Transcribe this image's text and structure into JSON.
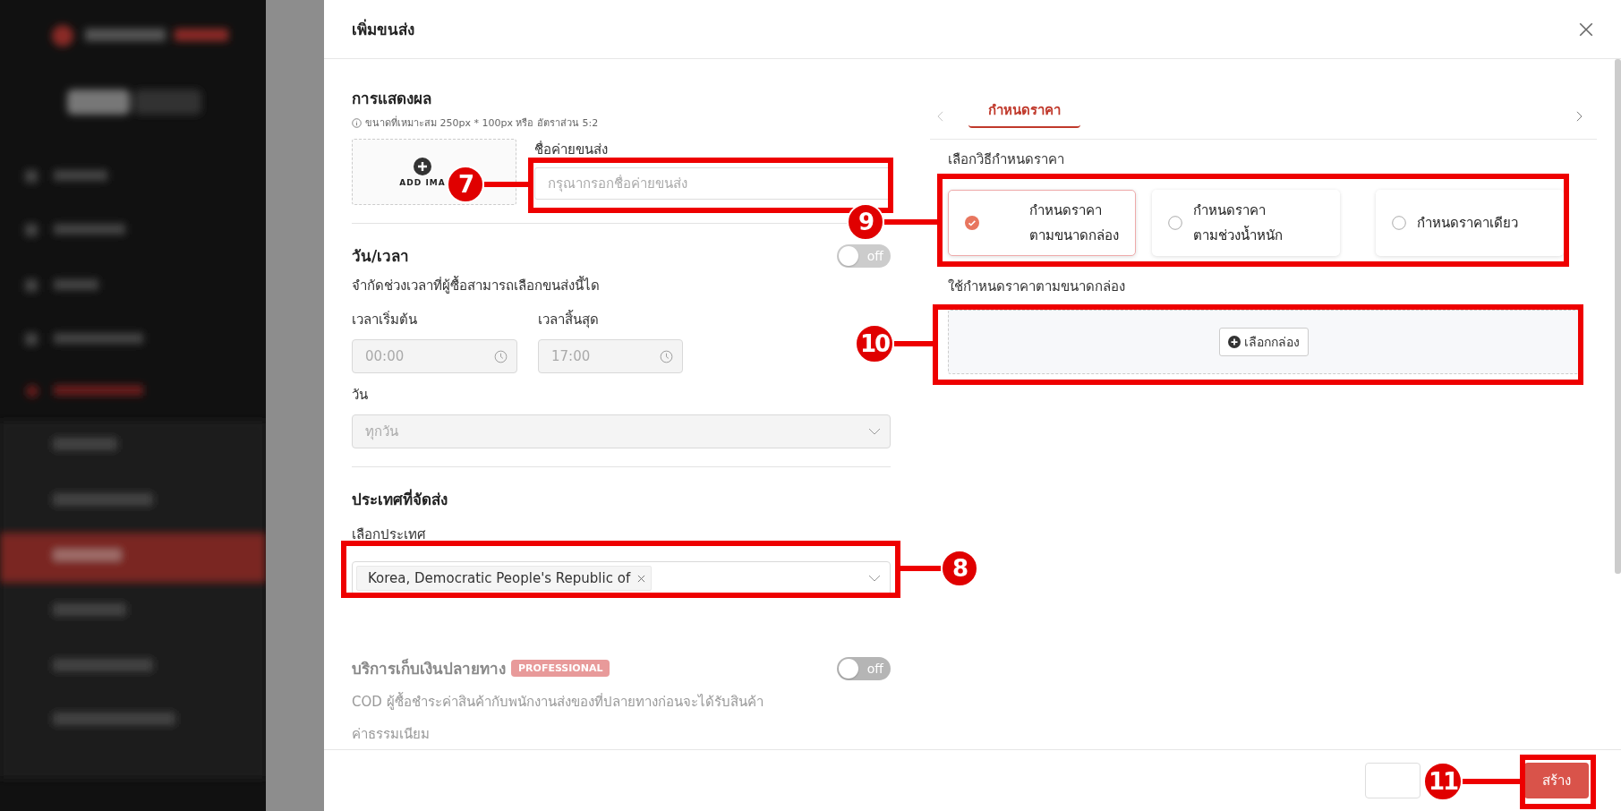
{
  "drawer": {
    "title": "เพิ่มขนส่ง"
  },
  "display": {
    "heading": "การแสดงผล",
    "hint": "ขนาดที่เหมาะสม 250px * 100px หรือ อัตราส่วน 5:2",
    "image_label": "ADD IMA",
    "name_label": "ชื่อค่ายขนส่ง",
    "name_placeholder": "กรุณากรอกชื่อค่ายขนส่ง"
  },
  "schedule": {
    "heading": "วัน/เวลา",
    "toggle": {
      "on": false,
      "label": "off"
    },
    "description": "จำกัดช่วงเวลาที่ผู้ซื้อสามารถเลือกขนส่งนี้ได",
    "start_label": "เวลาเริ่มต้น",
    "start_value": "00:00",
    "end_label": "เวลาสิ้นสุด",
    "end_value": "17:00",
    "day_label": "วัน",
    "day_value": "ทุกวัน"
  },
  "country": {
    "heading": "ประเทศที่จัดส่ง",
    "label": "เลือกประเทศ",
    "tags": [
      "Korea, Democratic People's Republic of"
    ]
  },
  "cod": {
    "heading": "บริการเก็บเงินปลายทาง",
    "badge": "PROFESSIONAL",
    "toggle": {
      "on": false,
      "label": "off"
    },
    "description": "COD ผู้ซื้อชำระค่าสินค้ากับพนักงานส่งของที่ปลายทางก่อนจะได้รับสินค้า",
    "fee_label": "ค่าธรรมเนียม"
  },
  "tabs": [
    {
      "label": "กำหนดราคา",
      "selected": true
    }
  ],
  "pricing": {
    "label": "เลือกวิธีกำหนดราคา",
    "options": [
      {
        "lines": [
          "กำหนดราคา",
          "ตามขนาดกล่อง"
        ],
        "selected": true
      },
      {
        "lines": [
          "กำหนดราคา",
          "ตามช่วงน้ำหนัก"
        ],
        "selected": false
      },
      {
        "lines": [
          "กำหนดราคาเดียว"
        ],
        "selected": false
      }
    ],
    "note": "ใช้กำหนดราคาตามขนาดกล่อง",
    "box_button": "เลือกกล่อง"
  },
  "footer": {
    "create_button": "สร้าง"
  },
  "annotations": [
    {
      "number": "7"
    },
    {
      "number": "8"
    },
    {
      "number": "9"
    },
    {
      "number": "10"
    },
    {
      "number": "11"
    }
  ]
}
